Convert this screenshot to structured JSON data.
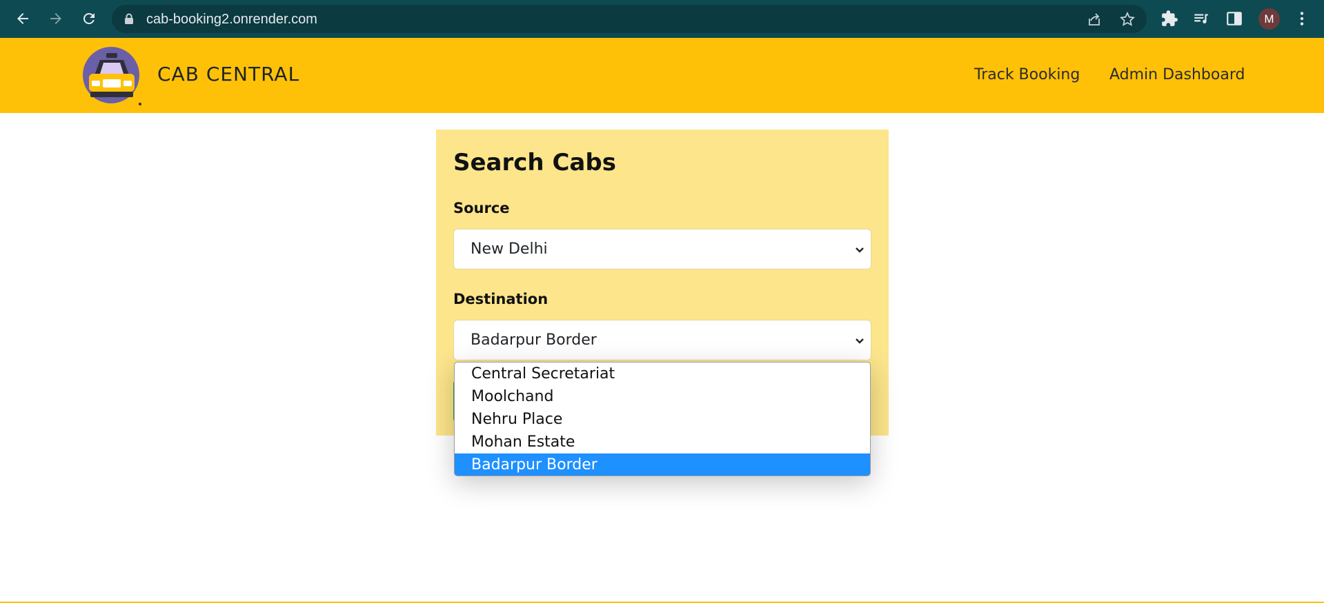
{
  "browser": {
    "url": "cab-booking2.onrender.com",
    "profile_initial": "M"
  },
  "header": {
    "brand": "CAB CENTRAL",
    "nav": [
      "Track Booking",
      "Admin Dashboard"
    ]
  },
  "search": {
    "title": "Search Cabs",
    "source_label": "Source",
    "source_value": "New Delhi",
    "destination_label": "Destination",
    "destination_value": "Badarpur Border",
    "destination_options": [
      "Central Secretariat",
      "Moolchand",
      "Nehru Place",
      "Mohan Estate",
      "Badarpur Border"
    ],
    "selected_option": "Badarpur Border"
  },
  "colors": {
    "chrome": "#0e4a52",
    "header": "#ffc107",
    "card": "#fce58b",
    "highlight": "#1e90ff",
    "button": "#28a745"
  }
}
